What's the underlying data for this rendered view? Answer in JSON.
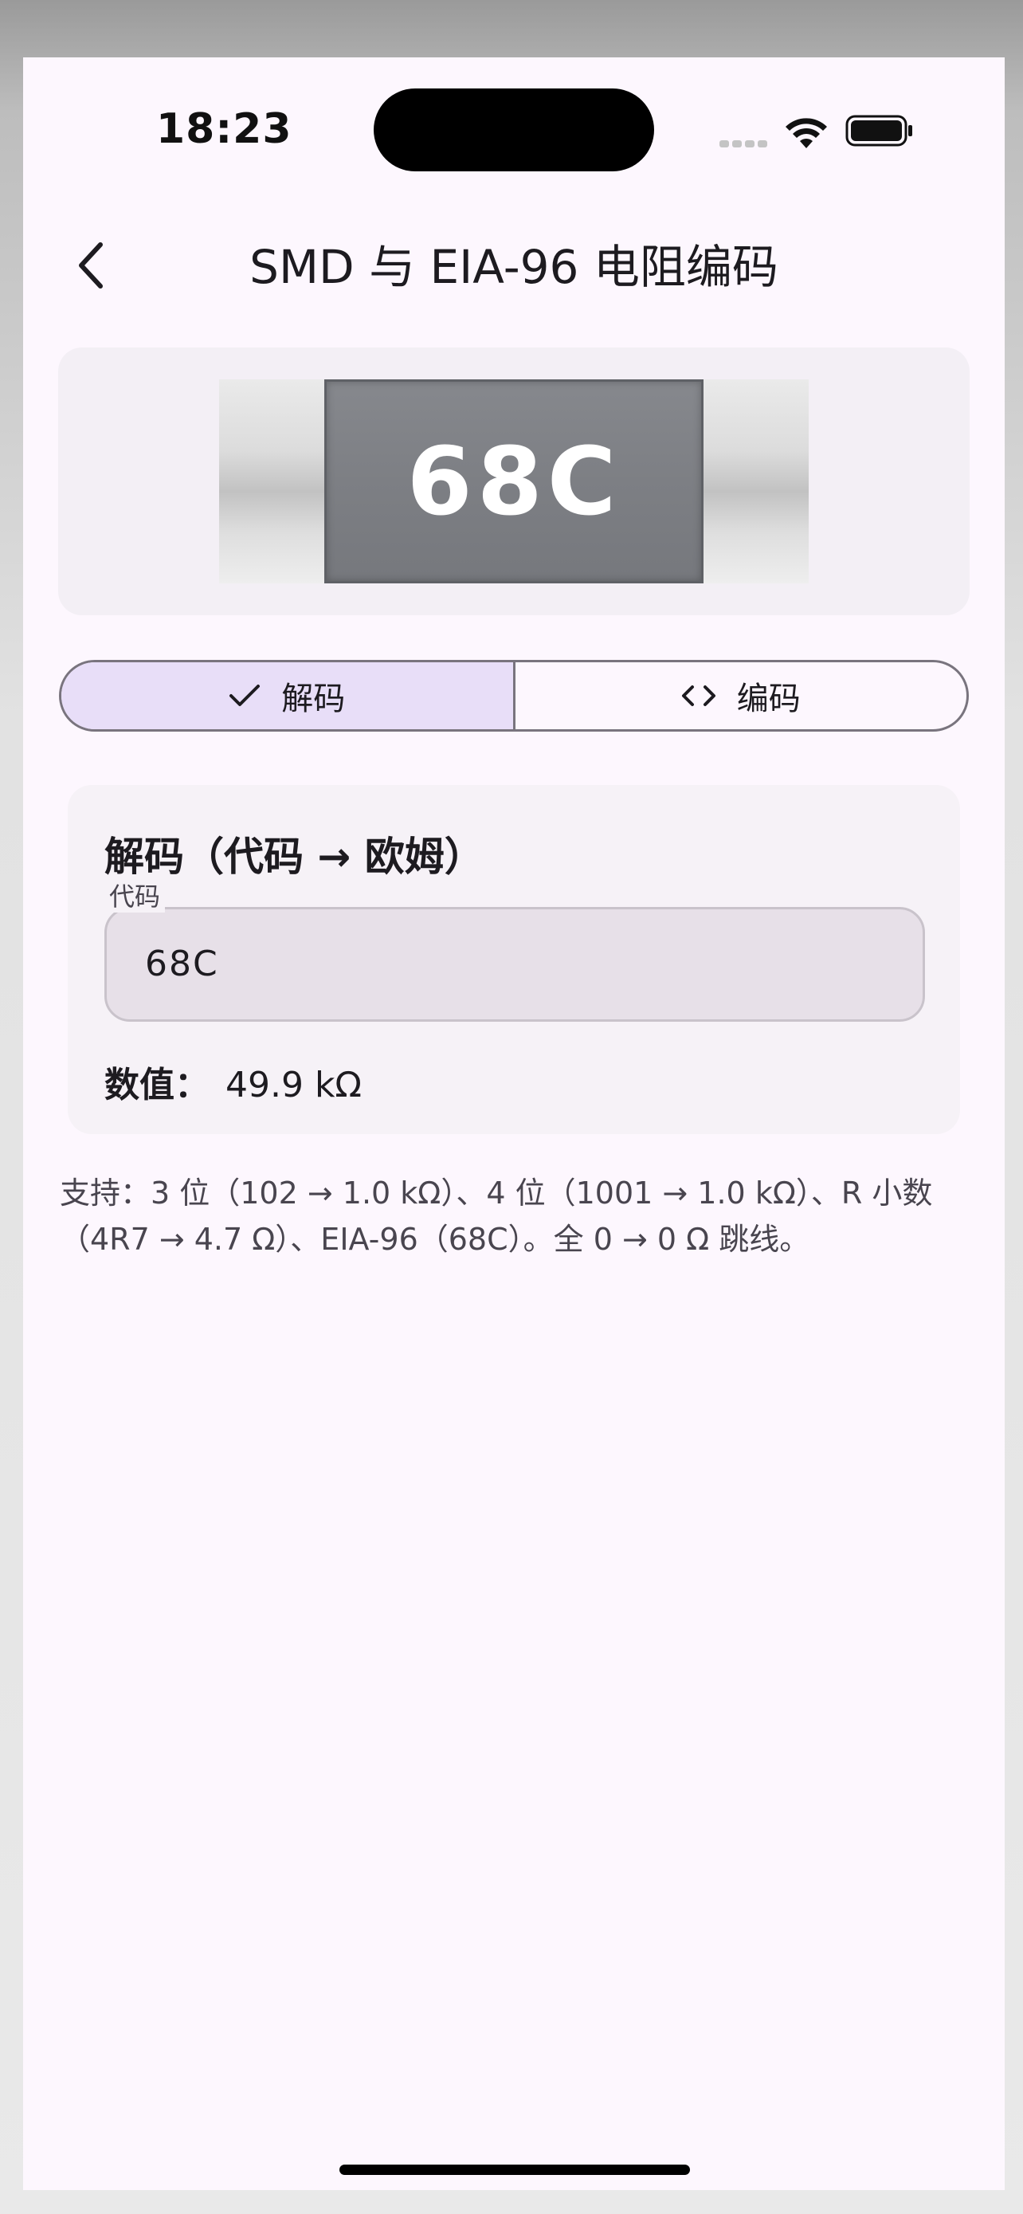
{
  "status_bar": {
    "time": "18:23"
  },
  "header": {
    "title": "SMD 与 EIA-96 电阻编码",
    "back_icon": "chevron-left-icon"
  },
  "preview": {
    "chip_code": "68C"
  },
  "segmented": {
    "decode_label": "解码",
    "encode_label": "编码",
    "selected": "decode"
  },
  "decode_card": {
    "title": "解码（代码 → 欧姆）",
    "field_label": "代码",
    "field_value": "68C",
    "value_label": "数值：",
    "value": "49.9 kΩ"
  },
  "help_text": "支持：3 位（102 → 1.0 kΩ）、4 位（1001 → 1.0 kΩ）、R 小数（4R7 → 4.7 Ω）、EIA-96（68C）。全 0 → 0 Ω 跳线。",
  "colors": {
    "background": "#fdf7fe",
    "selected_segment": "#e8def8",
    "outline": "#79747e",
    "chip_body": "#7d7f84"
  }
}
